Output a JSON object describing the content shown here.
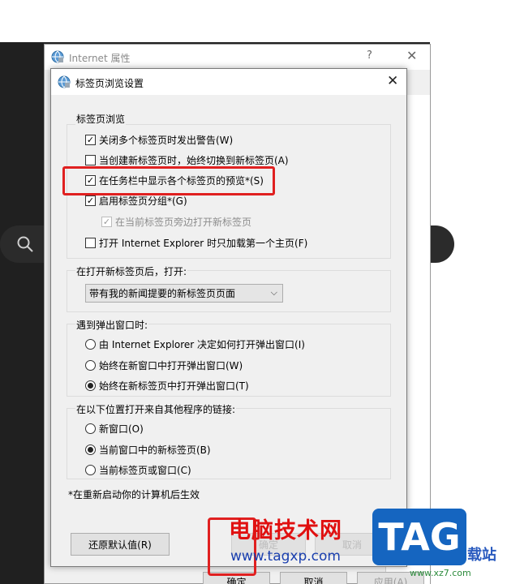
{
  "background": {
    "accent_dark": "#202020"
  },
  "ie_window": {
    "title": "Internet 属性",
    "help_label": "?",
    "close_label": "✕",
    "ok_label": "确定",
    "cancel_label": "取消",
    "apply_label": "应用(A)"
  },
  "dialog": {
    "title": "标签页浏览设置",
    "close_label": "✕",
    "group_tab_browsing": {
      "legend": "标签页浏览",
      "options": [
        {
          "label": "关闭多个标签页时发出警告(W)",
          "checked": true
        },
        {
          "label": "当创建新标签页时，始终切换到新标签页(A)",
          "checked": false
        },
        {
          "label": "在任务栏中显示各个标签页的预览*(S)",
          "checked": true
        },
        {
          "label": "启用标签页分组*(G)",
          "checked": true
        },
        {
          "label": "在当前标签页旁边打开新标签页",
          "checked": true,
          "disabled": true
        },
        {
          "label": "打开 Internet Explorer 时只加载第一个主页(F)",
          "checked": false
        }
      ]
    },
    "group_new_tab": {
      "legend": "在打开新标签页后，打开:",
      "selected": "带有我的新闻提要的新标签页页面"
    },
    "group_popup": {
      "legend": "遇到弹出窗口时:",
      "options": [
        {
          "label": "由 Internet Explorer 决定如何打开弹出窗口(I)",
          "selected": false
        },
        {
          "label": "始终在新窗口中打开弹出窗口(W)",
          "selected": false
        },
        {
          "label": "始终在新标签页中打开弹出窗口(T)",
          "selected": true
        }
      ]
    },
    "group_links": {
      "legend": "在以下位置打开来自其他程序的链接:",
      "options": [
        {
          "label": "新窗口(O)",
          "selected": false
        },
        {
          "label": "当前窗口中的新标签页(B)",
          "selected": true
        },
        {
          "label": "当前标签页或窗口(C)",
          "selected": false
        }
      ]
    },
    "note": "*在重新启动你的计算机后生效",
    "restore_label": "还原默认值(R)",
    "ok_label": "确定",
    "cancel_label": "取消"
  },
  "watermark": {
    "main": "电脑技术网",
    "url": "www.tagxp.com",
    "tag": "TAG",
    "side": "载站",
    "small": "www.xz7.com",
    "highlight_color": "#e02020"
  }
}
